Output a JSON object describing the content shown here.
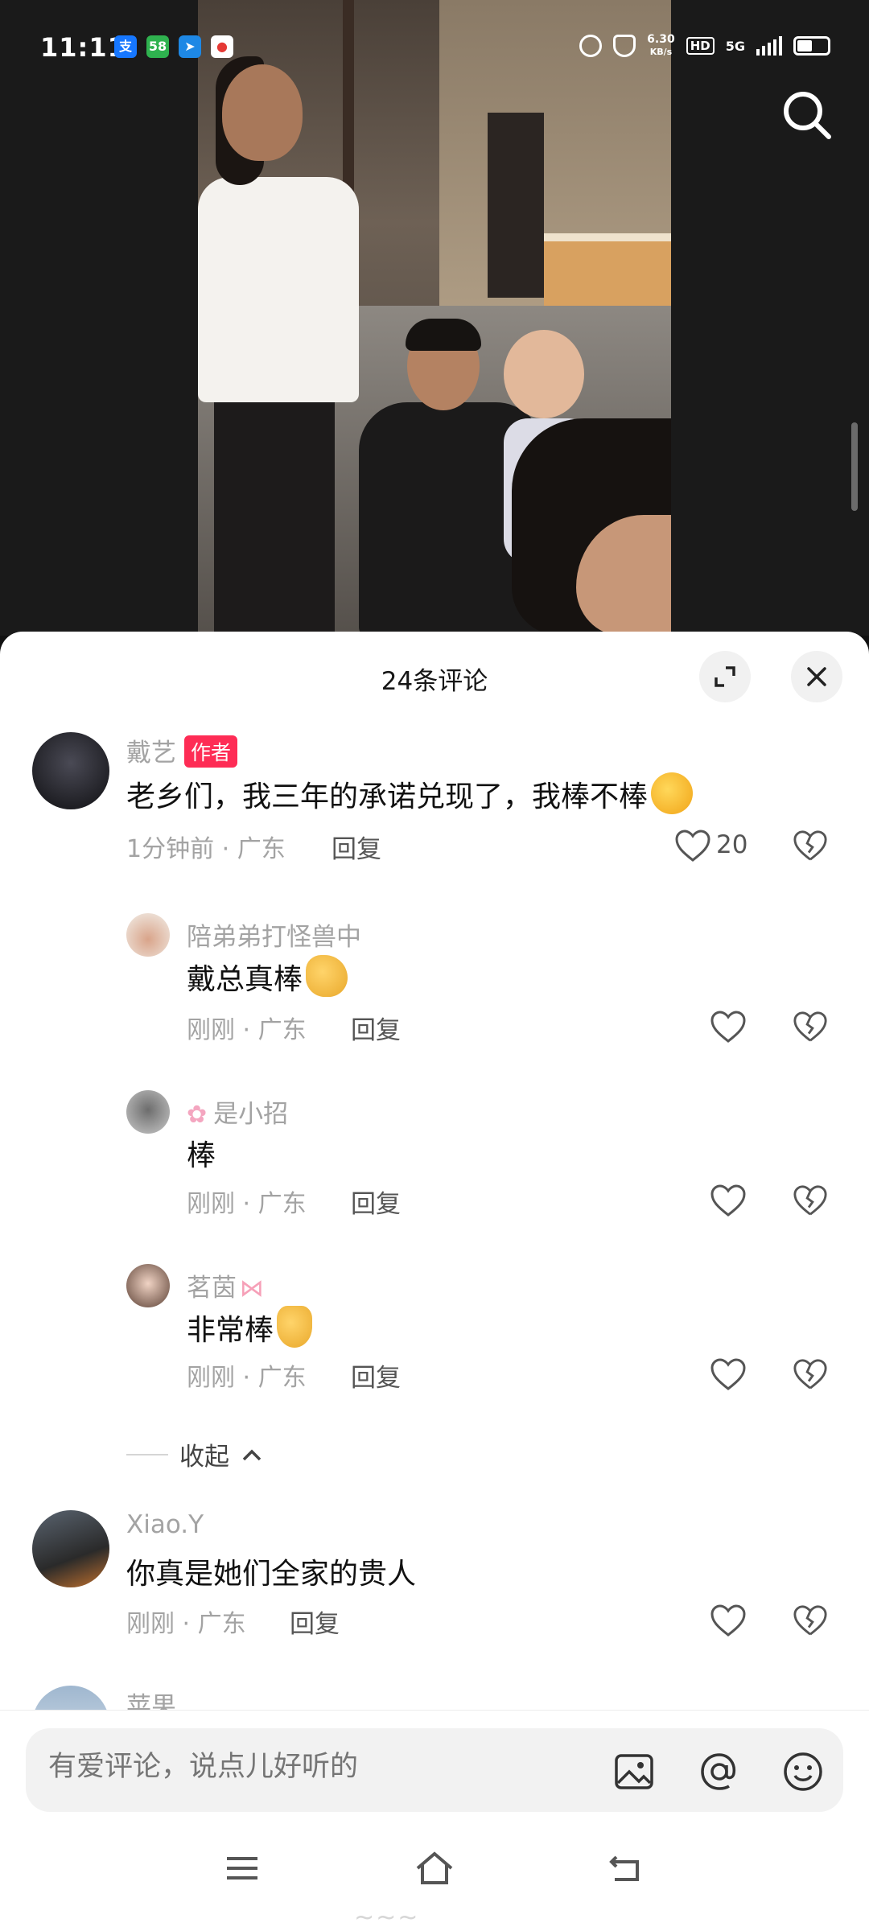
{
  "status_bar": {
    "time": "11:11",
    "speed_value": "6.30",
    "speed_unit": "KB/s",
    "hd": "HD",
    "network": "5G",
    "battery_percent": 44
  },
  "sheet": {
    "title": "24条评论"
  },
  "comments": [
    {
      "name": "戴艺",
      "badge": "作者",
      "text": "老乡们，我三年的承诺兑现了，我棒不棒",
      "meta": "1分钟前 · 广东",
      "reply": "回复",
      "likes": "20"
    },
    {
      "name": "陪弟弟打怪兽中",
      "text": "戴总真棒",
      "meta": "刚刚 · 广东",
      "reply": "回复"
    },
    {
      "name": "是小招",
      "text": "棒",
      "meta": "刚刚 · 广东",
      "reply": "回复"
    },
    {
      "name": "茗茵",
      "text": "非常棒",
      "meta": "刚刚 · 广东",
      "reply": "回复"
    },
    {
      "name": "Xiao.Y",
      "text": "你真是她们全家的贵人",
      "meta": "刚刚 · 广东",
      "reply": "回复"
    },
    {
      "name": "苹果"
    }
  ],
  "collapse": {
    "label": "收起"
  },
  "input": {
    "placeholder": "有爱评论，说点儿好听的"
  },
  "icons": {
    "search": "search-icon",
    "expand": "expand-icon",
    "close": "close-icon",
    "like": "heart-icon",
    "dislike": "broken-heart-icon",
    "image": "image-icon",
    "mention": "at-icon",
    "emoji": "emoji-icon",
    "menu": "menu-icon",
    "home": "home-icon",
    "back": "back-icon"
  },
  "colors": {
    "badge": "#fe2c55",
    "sheet_bg": "#ffffff",
    "muted_text": "#a3a3a3"
  }
}
